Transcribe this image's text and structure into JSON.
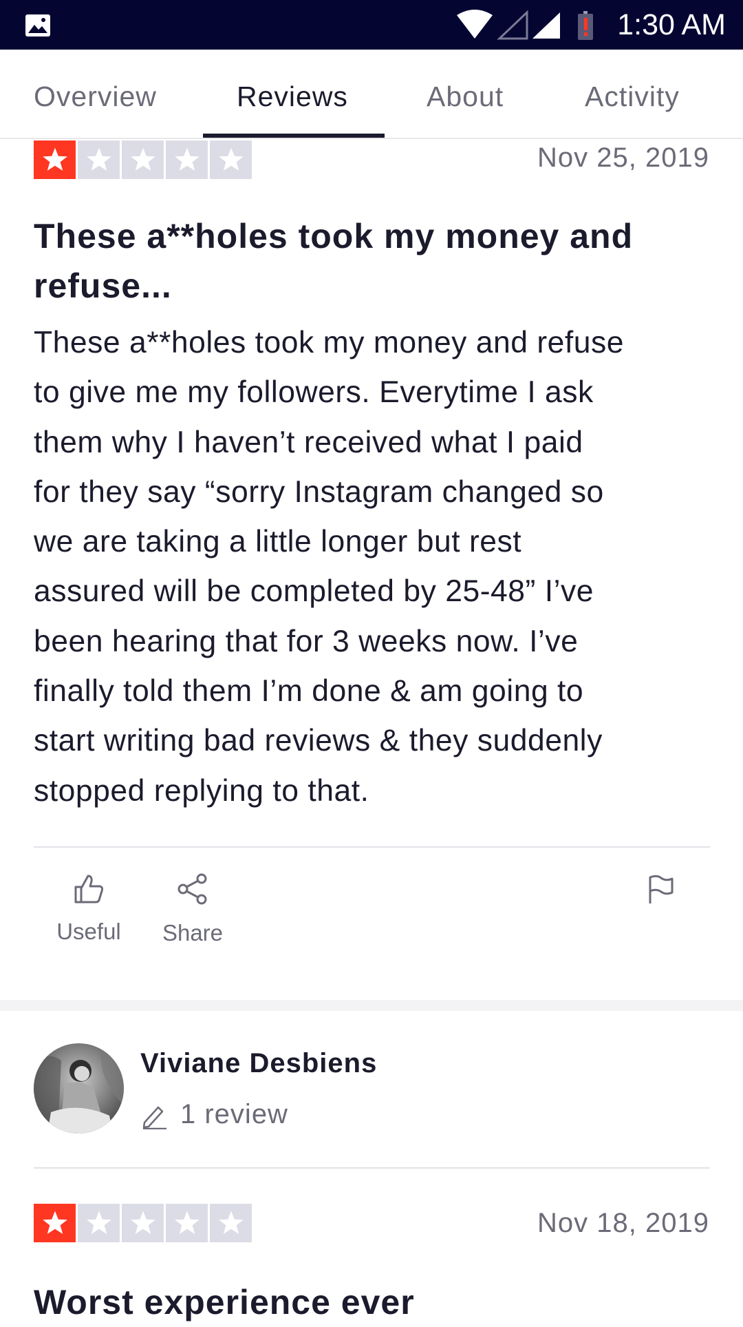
{
  "status_bar": {
    "time": "1:30 AM"
  },
  "tabs": [
    {
      "label": "Overview",
      "active": false
    },
    {
      "label": "Reviews",
      "active": true
    },
    {
      "label": "About",
      "active": false
    },
    {
      "label": "Activity",
      "active": false
    }
  ],
  "reviews": [
    {
      "rating": 1,
      "max_rating": 5,
      "date": "Nov 25, 2019",
      "title_line1": "These a**holes took my money and",
      "title_line2": "refuse...",
      "body_lines": [
        "These a**holes took my money and refuse",
        "to give me my followers. Everytime I ask",
        "them why I haven’t received what I paid",
        "for they say “sorry Instagram changed so",
        "we are taking a little longer but rest",
        "assured will be completed by 25-48” I’ve",
        "been hearing that for 3 weeks now. I’ve",
        "finally told them I’m done & am going to",
        "start writing bad reviews & they suddenly",
        "stopped replying to that."
      ],
      "actions": {
        "useful_label": "Useful",
        "share_label": "Share"
      }
    },
    {
      "reviewer_name": "Viviane Desbiens",
      "reviewer_review_count": "1 review",
      "rating": 1,
      "max_rating": 5,
      "date": "Nov 18, 2019",
      "title_line1": "Worst experience ever"
    }
  ],
  "colors": {
    "status_bar": "#050532",
    "star_on": "#ff3722",
    "star_off": "#dcdce6",
    "text_dark": "#1b1b2d",
    "text_muted": "#6b6b78"
  }
}
